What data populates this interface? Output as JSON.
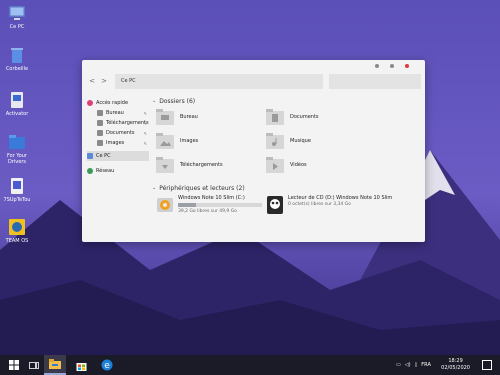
{
  "desktop": {
    "icons": [
      {
        "label": "Ce PC",
        "icon": "computer-icon"
      },
      {
        "label": "Corbeille",
        "icon": "recycle-bin-icon"
      },
      {
        "label": "Activator",
        "icon": "activator-icon"
      },
      {
        "label": "For Your Drivers",
        "icon": "drivers-folder-icon"
      },
      {
        "label": "7SUpTeTou",
        "icon": "app-icon"
      },
      {
        "label": "TEAM OS",
        "icon": "team-os-icon"
      }
    ]
  },
  "explorer": {
    "address": "Ce PC",
    "nav": {
      "back": "<",
      "forward": ">"
    },
    "titlebar_colors": {
      "minimize": "#8a8a8a",
      "maximize": "#8a8a8a",
      "close": "#e03a3a"
    },
    "sidebar": {
      "items": [
        {
          "label": "Accès rapide",
          "icon": "star-icon",
          "color": "#e0407a"
        },
        {
          "label": "Bureau",
          "icon": "desktop-folder-icon",
          "color": "#8a8a8a",
          "pinned": true
        },
        {
          "label": "Téléchargements",
          "icon": "download-folder-icon",
          "color": "#8a8a8a",
          "pinned": true
        },
        {
          "label": "Documents",
          "icon": "documents-folder-icon",
          "color": "#8a8a8a",
          "pinned": true
        },
        {
          "label": "Images",
          "icon": "images-folder-icon",
          "color": "#8a8a8a",
          "pinned": true
        },
        {
          "label": "Ce PC",
          "icon": "pc-icon",
          "color": "#5a8ad8"
        },
        {
          "label": "Réseau",
          "icon": "network-icon",
          "color": "#3a9a5a"
        }
      ],
      "pin_glyph": "✎"
    },
    "folders_section": {
      "header": "Dossiers (6)",
      "folders": [
        {
          "label": "Bureau",
          "icon": "desktop-folder-icon"
        },
        {
          "label": "Documents",
          "icon": "documents-folder-icon"
        },
        {
          "label": "Images",
          "icon": "images-folder-icon"
        },
        {
          "label": "Musique",
          "icon": "music-folder-icon"
        },
        {
          "label": "Téléchargements",
          "icon": "downloads-folder-icon"
        },
        {
          "label": "Vidéos",
          "icon": "videos-folder-icon"
        }
      ]
    },
    "devices_section": {
      "header": "Périphériques et lecteurs (2)",
      "drives": [
        {
          "name": "Windows Note 10 Slim (C:)",
          "free": "39,2 Go libres sur 49,9 Go",
          "used_fraction": 0.21,
          "icon": "hard-drive-icon"
        },
        {
          "name": "Lecteur de CD (D:) Windows Note 10 Slim",
          "free": "0 octet(s) libres sur 3,34 Go",
          "icon": "cd-drive-icon"
        }
      ]
    }
  },
  "taskbar": {
    "items": [
      {
        "icon": "windows-start-icon"
      },
      {
        "icon": "task-view-icon"
      },
      {
        "icon": "file-explorer-icon",
        "active": true
      },
      {
        "icon": "store-icon"
      },
      {
        "icon": "edge-icon"
      }
    ],
    "tray": {
      "language": "FRA",
      "time": "18:29",
      "date": "02/05/2020"
    }
  }
}
